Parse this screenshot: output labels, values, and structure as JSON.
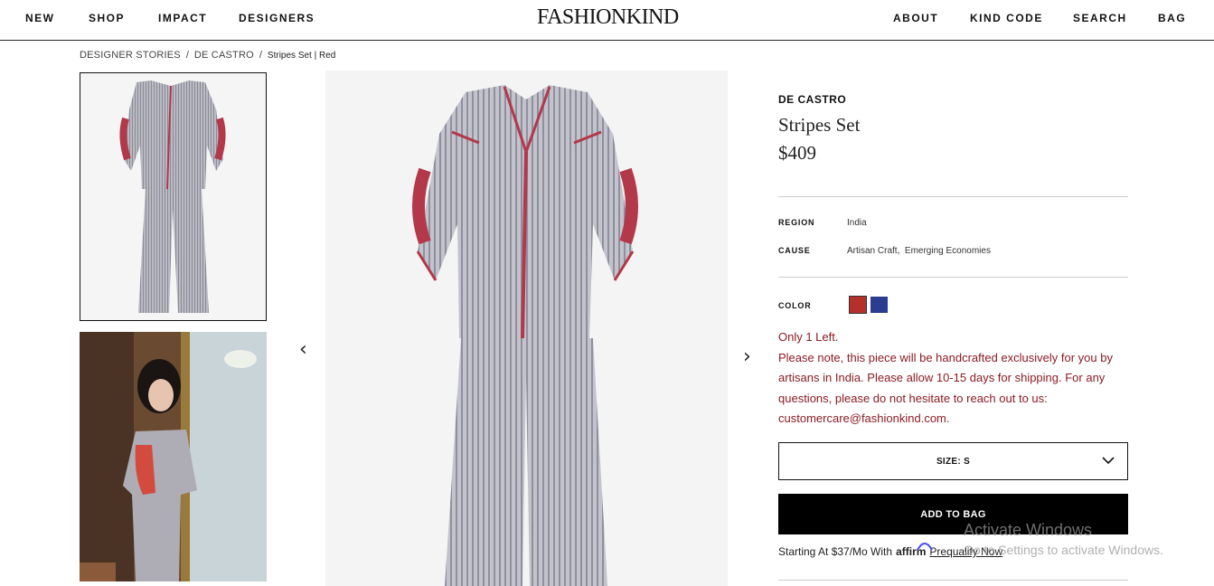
{
  "header": {
    "nav_left": [
      "NEW",
      "SHOP",
      "IMPACT",
      "DESIGNERS"
    ],
    "logo": "FASHIONKIND",
    "nav_right": [
      "ABOUT",
      "KIND CODE",
      "SEARCH",
      "BAG"
    ]
  },
  "breadcrumb": {
    "items": [
      "DESIGNER STORIES",
      "DE CASTRO",
      "Stripes Set | Red"
    ],
    "separator": "/"
  },
  "gallery": {
    "prev_arrow": "‹",
    "next_arrow": "›"
  },
  "product": {
    "brand": "DE CASTRO",
    "name": "Stripes Set",
    "price": "$409",
    "region_label": "REGION",
    "region_value": "India",
    "cause_label": "CAUSE",
    "cause_value": "Artisan Craft,  Emerging Economies",
    "color_label": "COLOR",
    "colors": [
      "#b5302b",
      "#2c3d8f"
    ],
    "stock": "Only 1 Left.",
    "note": "Please note, this piece will be handcrafted exclusively for you by artisans in India. Please allow 10-15 days for shipping. For any questions, please do not hesitate to reach out to us: customercare@fashionkind.com.",
    "size_label": "SIZE: S",
    "add_to_bag": "ADD TO BAG",
    "financing_prefix": "Starting At $37/Mo With",
    "affirm": "affirm",
    "prequalify": "Prequalify Now"
  },
  "watermark": {
    "line1": "Activate Windows",
    "line2": "Go to Settings to activate Windows."
  },
  "colors": {
    "accent_red": "#8b1c24",
    "black": "#000000"
  }
}
